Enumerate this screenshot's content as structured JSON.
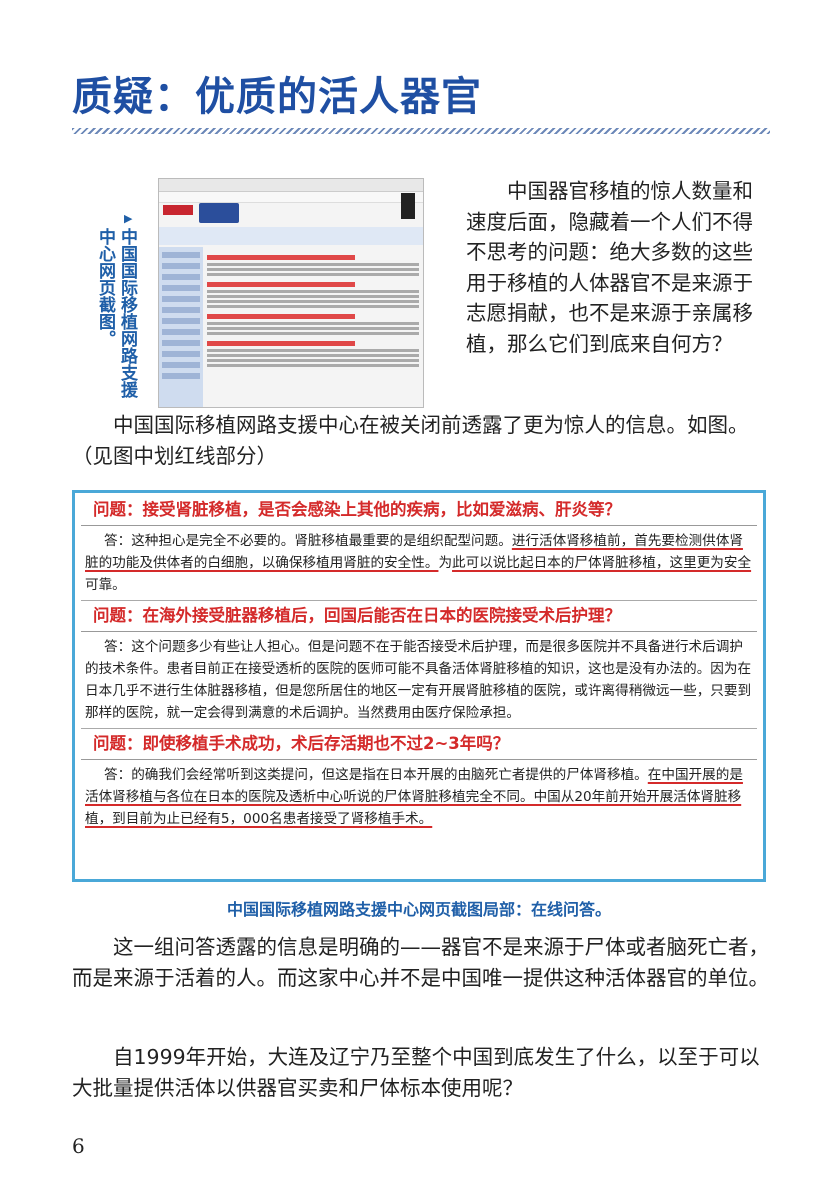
{
  "page": {
    "title": "质疑：优质的活人器官",
    "page_number": "6"
  },
  "figure1": {
    "caption": "中国国际移植网路支援中心网页截图。"
  },
  "paragraphs": {
    "p1": "中国器官移植的惊人数量和速度后面，隐藏着一个人们不得不思考的问题：绝大多数的这些用于移植的人体器官不是来源于志愿捐献，也不是来源于亲属移植，那么它们到底来自何方？",
    "p2": "中国国际移植网路支援中心在被关闭前透露了更为惊人的信息。如图。（见图中划红线部分）",
    "p3": "这一组问答透露的信息是明确的——器官不是来源于尸体或者脑死亡者，而是来源于活着的人。而这家中心并不是中国唯一提供这种活体器官的单位。",
    "p4": "自1999年开始，大连及辽宁乃至整个中国到底发生了什么，以至于可以大批量提供活体以供器官买卖和尸体标本使用呢？"
  },
  "qa": {
    "q1": "问题：接受肾脏移植，是否会感染上其他的疾病，比如爱滋病、肝炎等？",
    "a1_part1": "答：这种担心是完全不必要的。肾脏移植最重要的是组织配型问题。",
    "a1_part2": "进行活体肾移植前，首先要检测供体肾脏的功能及供体者的白细胞，以确保移植用肾脏的安全性。",
    "a1_part3": "为",
    "a1_part4": "此可以说比起日本的尸体肾脏移植，这里更为安全",
    "a1_part5": "可靠。",
    "q2": "问题：在海外接受脏器移植后，回国后能否在日本的医院接受术后护理？",
    "a2": "答：这个问题多少有些让人担心。但是问题不在于能否接受术后护理，而是很多医院并不具备进行术后调护的技术条件。患者目前正在接受透析的医院的医师可能不具备活体肾脏移植的知识，这也是没有办法的。因为在日本几乎不进行生体脏器移植，但是您所居住的地区一定有开展肾脏移植的医院，或许离得稍微远一些，只要到那样的医院，就一定会得到满意的术后调护。当然费用由医疗保险承担。",
    "q3": "问题：即使移植手术成功，术后存活期也不过2~3年吗？",
    "a3_part1": "答：的确我们会经常听到这类提问，但这是指在日本开展的由脑死亡者提供的尸体肾移植。",
    "a3_part2": "在中国开展的是活体肾移植与各位在日本的医院及透析中心听说的尸体肾脏移植完全不同。中国从20年前开始开展活体肾脏移植，到目前为止已经有5，000名患者接受了肾移植手术。",
    "caption": "中国国际移植网路支援中心网页截图局部：在线问答。"
  }
}
